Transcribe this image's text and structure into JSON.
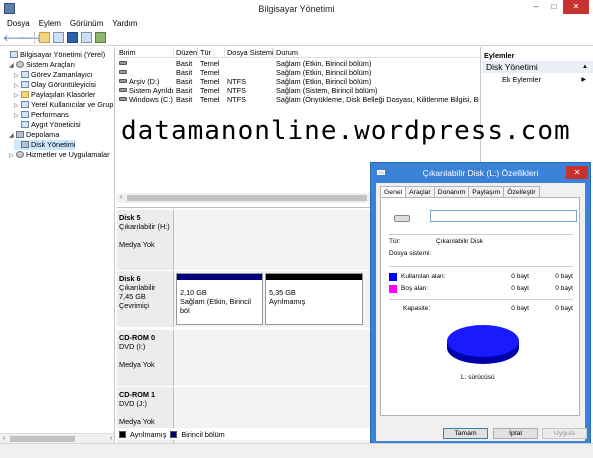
{
  "window": {
    "title": "Bilgisayar Yönetimi",
    "controls": [
      "–",
      "□",
      "✕"
    ]
  },
  "menu": [
    "Dosya",
    "Eylem",
    "Görünüm",
    "Yardım"
  ],
  "toolbar": {
    "back": "🡐",
    "forward": "🡒"
  },
  "tree": [
    {
      "label": "Bilgisayar Yönetimi (Yerel)",
      "indent": 0,
      "exp": "",
      "icon": "computer"
    },
    {
      "label": "Sistem Araçları",
      "indent": 1,
      "exp": "◢",
      "icon": "gear"
    },
    {
      "label": "Görev Zamanlayıcı",
      "indent": 2,
      "exp": "▷",
      "icon": "clock"
    },
    {
      "label": "Olay Görüntüleyicisi",
      "indent": 2,
      "exp": "▷",
      "icon": "log"
    },
    {
      "label": "Paylaşılan Klasörler",
      "indent": 2,
      "exp": "▷",
      "icon": "folder"
    },
    {
      "label": "Yerel Kullanıcılar ve Gruplar",
      "indent": 2,
      "exp": "▷",
      "icon": "users"
    },
    {
      "label": "Performans",
      "indent": 2,
      "exp": "▷",
      "icon": "perf"
    },
    {
      "label": "Aygıt Yöneticisi",
      "indent": 2,
      "exp": "",
      "icon": "device"
    },
    {
      "label": "Depolama",
      "indent": 1,
      "exp": "◢",
      "icon": "disk"
    },
    {
      "label": "Disk Yönetimi",
      "indent": 2,
      "exp": "",
      "icon": "disk",
      "selected": true
    },
    {
      "label": "Hizmetler ve Uygulamalar",
      "indent": 1,
      "exp": "▷",
      "icon": "gear"
    }
  ],
  "volumes": {
    "headers": [
      "Birim",
      "Düzen",
      "Tür",
      "Dosya Sistemi",
      "Durum"
    ],
    "rows": [
      [
        "",
        "Basit",
        "Temel",
        "",
        "Sağlam (Etkin, Birincil bölüm)"
      ],
      [
        "",
        "Basit",
        "Temel",
        "",
        "Sağlam (Etkin, Birincil bölüm)"
      ],
      [
        "Arşiv (D:)",
        "Basit",
        "Temel",
        "NTFS",
        "Sağlam (Etkin, Birincil bölüm)"
      ],
      [
        "Sistem Ayrıldı",
        "Basit",
        "Temel",
        "NTFS",
        "Sağlam (Sistem, Birincil bölüm)"
      ],
      [
        "Windows (C:)",
        "Basit",
        "Temel",
        "NTFS",
        "Sağlam (Önyükleme, Disk Belleği Dosyası, Kilitlenme Bilgisi, Birincil"
      ]
    ]
  },
  "disks": [
    {
      "name": "Disk 5",
      "l2": "Çıkarılabilir (H:)",
      "l3": "",
      "l4": "Medya Yok",
      "parts": []
    },
    {
      "name": "Disk 6",
      "l2": "Çıkarılabilir",
      "l3": "7,45 GB",
      "l4": "Çevrimiçi",
      "parts": [
        {
          "size": "2,10 GB",
          "status": "Sağlam (Etkin, Birincil böl",
          "bar": "#00007f"
        },
        {
          "size": "5,35 GB",
          "status": "Ayrılmamış",
          "bar": "#000000"
        }
      ]
    },
    {
      "name": "CD-ROM 0",
      "l2": "DVD (I:)",
      "l3": "",
      "l4": "Medya Yok",
      "parts": []
    },
    {
      "name": "CD-ROM 1",
      "l2": "DVD (J:)",
      "l3": "",
      "l4": "Medya Yok",
      "parts": []
    }
  ],
  "legend": [
    {
      "label": "Ayrılmamış",
      "color": "#000000"
    },
    {
      "label": "Birincil bölüm",
      "color": "#00007f"
    }
  ],
  "actions": {
    "title": "Eylemler",
    "section": "Disk Yönetimi",
    "item": "Ek Eylemler"
  },
  "watermark": "datamanonline.wordpress.com",
  "dialog": {
    "title": "Çıkarılabilir Disk (L:) Özellikleri",
    "tabs": [
      "Genel",
      "Araçlar",
      "Donanım",
      "Paylaşım",
      "Özelleştir"
    ],
    "name_value": "",
    "type_label": "Tür:",
    "type_value": "Çıkarılabilir Disk",
    "fs_label": "Dosya sistemi:",
    "used_label": "Kullanılan alan:",
    "used_bytes": "0 bayt",
    "used_short": "0 bayt",
    "free_label": "Boş alan:",
    "free_bytes": "0 bayt",
    "free_short": "0 bayt",
    "cap_label": "Kapasite:",
    "cap_bytes": "0 bayt",
    "cap_short": "0 bayt",
    "drive_label": "L: sürücüsü",
    "used_color": "#0000ff",
    "free_color": "#ff00ff",
    "buttons": {
      "ok": "Tamam",
      "cancel": "İptal",
      "apply": "Uygula"
    }
  }
}
